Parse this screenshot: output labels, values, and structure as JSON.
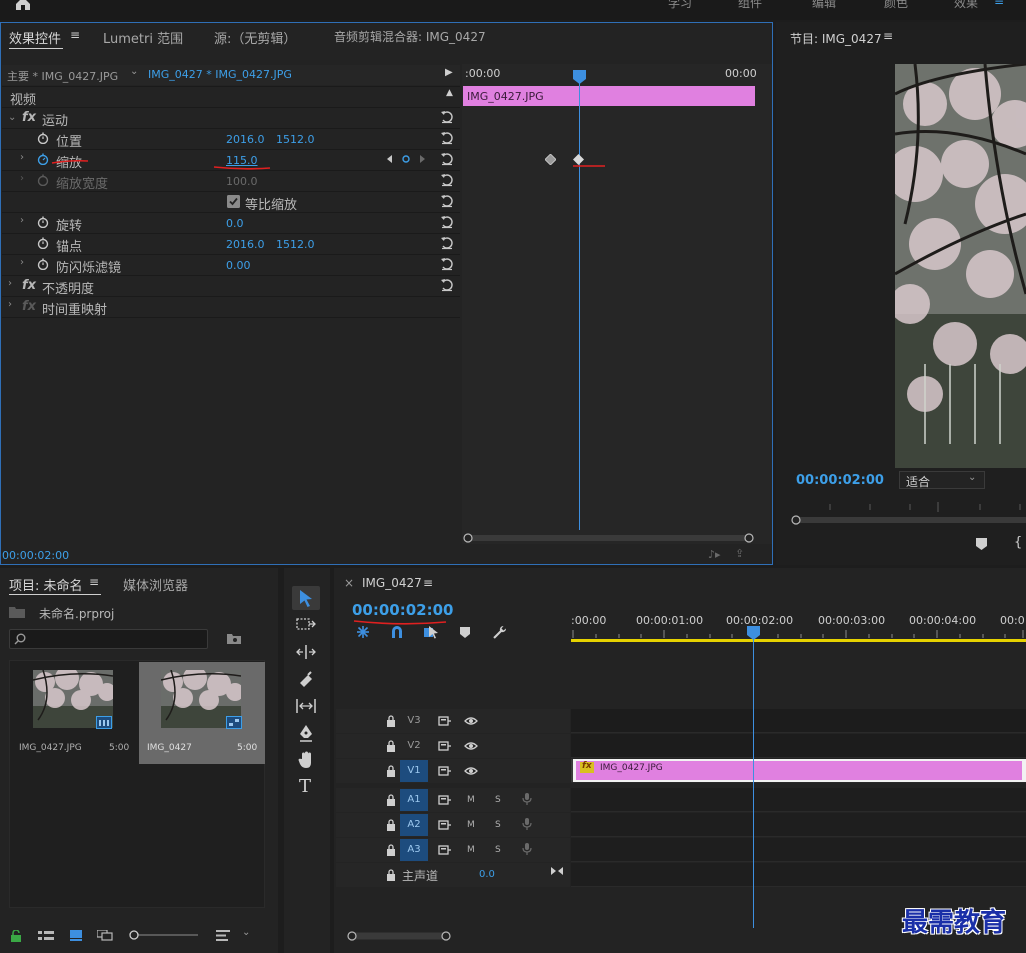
{
  "workspace_tabs": [
    "学习",
    "组件",
    "编辑",
    "颜色",
    "效果"
  ],
  "effect_controls": {
    "tabs": [
      "效果控件",
      "Lumetri 范围",
      "源:（无剪辑）",
      "音频剪辑混合器: IMG_0427"
    ],
    "master_label": "主要 * IMG_0427.JPG",
    "sequence_clip_label": "IMG_0427 * IMG_0427.JPG",
    "timeline_start": ":00:00",
    "timeline_end": "00:00",
    "clip_name": "IMG_0427.JPG",
    "section_video": "视频",
    "motion": "运动",
    "position": {
      "label": "位置",
      "x": "2016.0",
      "y": "1512.0"
    },
    "scale": {
      "label": "缩放",
      "value": "115.0"
    },
    "scale_width": {
      "label": "缩放宽度",
      "value": "100.0"
    },
    "uniform_scale": "等比缩放",
    "rotation": {
      "label": "旋转",
      "value": "0.0"
    },
    "anchor": {
      "label": "锚点",
      "x": "2016.0",
      "y": "1512.0"
    },
    "anti_flicker": {
      "label": "防闪烁滤镜",
      "value": "0.00"
    },
    "opacity": "不透明度",
    "time_remap": "时间重映射",
    "timecode": "00:00:02:00",
    "fx": "fx"
  },
  "program": {
    "title": "节目: IMG_0427",
    "timecode": "00:00:02:00",
    "fit": "适合"
  },
  "project": {
    "tabs": [
      "项目: 未命名",
      "媒体浏览器"
    ],
    "file": "未命名.prproj",
    "items": [
      {
        "name": "IMG_0427.JPG",
        "duration": "5:00"
      },
      {
        "name": "IMG_0427",
        "duration": "5:00"
      }
    ]
  },
  "timeline": {
    "close": "×",
    "title": "IMG_0427",
    "timecode": "00:00:02:00",
    "ruler": [
      ":00:00",
      "00:00:01:00",
      "00:00:02:00",
      "00:00:03:00",
      "00:00:04:00",
      "00:0"
    ],
    "video_tracks": [
      "V3",
      "V2",
      "V1"
    ],
    "audio_tracks": [
      "A1",
      "A2",
      "A3"
    ],
    "master_label": "主声道",
    "master_value": "0.0",
    "clip_name": "IMG_0427.JPG",
    "fx": "fx",
    "mute": "M",
    "solo": "S"
  },
  "watermark": "最需教育",
  "colors": {
    "accent_blue": "#3d9fe8",
    "clip_pink": "#e080e0",
    "annotation_red": "#e02020"
  }
}
